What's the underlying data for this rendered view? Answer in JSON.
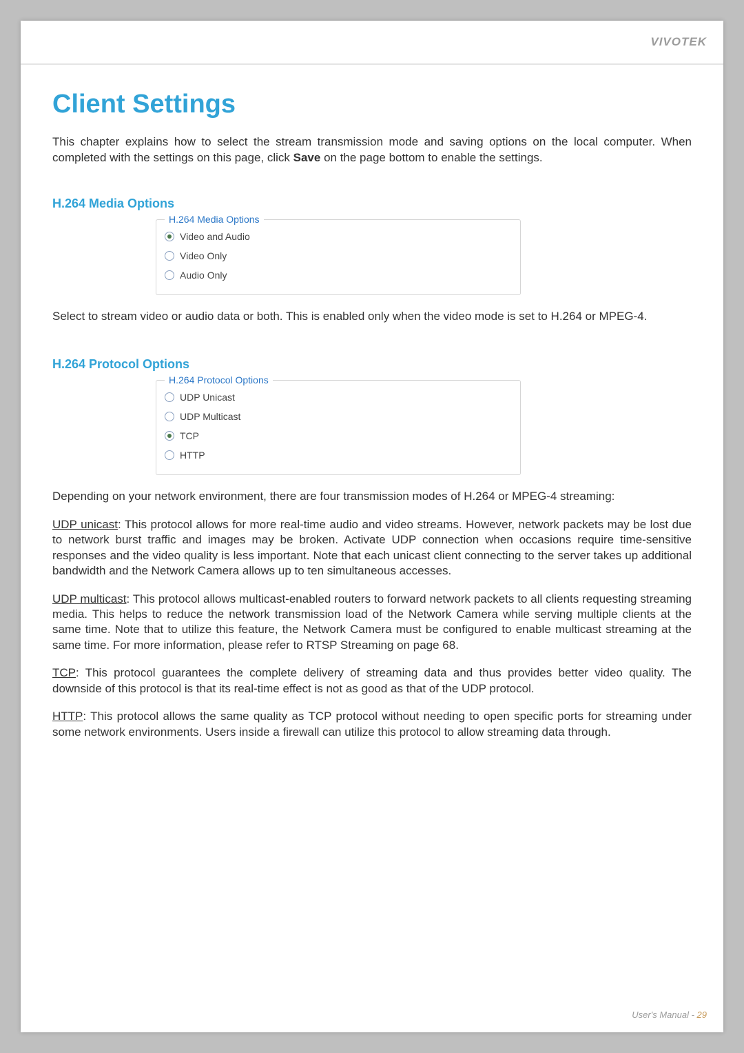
{
  "header": {
    "brand": "VIVOTEK"
  },
  "title": "Client Settings",
  "intro_before_save": "This chapter explains how to select the stream transmission mode and saving options on the local computer. When completed with the settings on this page, click ",
  "intro_save": "Save",
  "intro_after_save": " on the page bottom to enable the settings.",
  "media": {
    "title": "H.264 Media Options",
    "legend": "H.264 Media Options",
    "options": [
      {
        "label": "Video and Audio",
        "checked": true
      },
      {
        "label": "Video Only",
        "checked": false
      },
      {
        "label": "Audio Only",
        "checked": false
      }
    ],
    "note": "Select to stream video or audio data or both. This is enabled only when the video mode is set to H.264 or MPEG-4."
  },
  "protocol": {
    "title": "H.264 Protocol Options",
    "legend": "H.264 Protocol Options",
    "options": [
      {
        "label": "UDP Unicast",
        "checked": false
      },
      {
        "label": "UDP Multicast",
        "checked": false
      },
      {
        "label": "TCP",
        "checked": true
      },
      {
        "label": "HTTP",
        "checked": false
      }
    ],
    "intro": "Depending on your network environment, there are four transmission modes of H.264 or MPEG-4 streaming:",
    "items": [
      {
        "name": "UDP unicast",
        "desc": ": This protocol allows for more real-time audio and video streams. However, network packets may be lost due to network burst traffic and images may be broken. Activate UDP connection when occasions require time-sensitive responses and the video quality is less important. Note that each unicast client connecting to the server takes up additional bandwidth and the Network Camera allows up to ten simultaneous accesses."
      },
      {
        "name": "UDP multicast",
        "desc": ": This protocol allows multicast-enabled routers to forward network packets to all clients requesting streaming media. This helps to reduce the network transmission load of the Network Camera while serving multiple clients at the same time. Note that to utilize this feature, the Network Camera must be configured to enable multicast streaming at the same time. For more information, please refer to RTSP Streaming on page 68."
      },
      {
        "name": "TCP",
        "desc": ": This protocol guarantees the complete delivery of streaming data and thus provides better video quality. The downside of this protocol is that its real-time effect is not as good as that of the UDP protocol."
      },
      {
        "name": "HTTP",
        "desc": ": This protocol allows the same quality as TCP protocol without needing to open specific ports for streaming under some network environments. Users inside a firewall can utilize this protocol to allow streaming data through."
      }
    ]
  },
  "footer": {
    "label": "User's Manual - ",
    "page": "29"
  }
}
